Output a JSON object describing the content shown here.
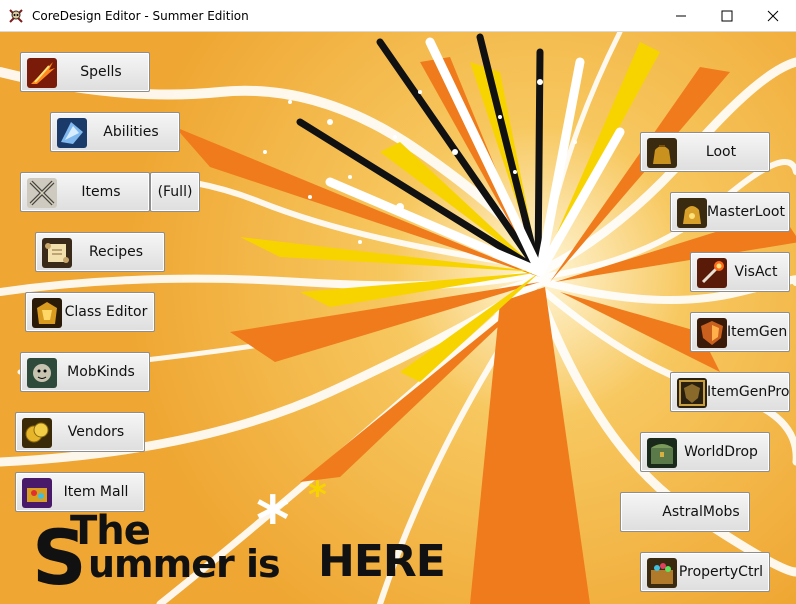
{
  "window": {
    "title": "CoreDesign Editor - Summer Edition"
  },
  "left_buttons": [
    {
      "label": "Spells",
      "icon": "fire-spell-icon"
    },
    {
      "label": "Abilities",
      "icon": "ice-shard-icon"
    },
    {
      "label": "Items",
      "icon": "crossed-swords-icon"
    },
    {
      "label": "Recipes",
      "icon": "scroll-icon"
    },
    {
      "label": "Class Editor",
      "icon": "golden-armor-icon"
    },
    {
      "label": "MobKinds",
      "icon": "creature-icon"
    },
    {
      "label": "Vendors",
      "icon": "gold-coins-icon"
    },
    {
      "label": "Item Mall",
      "icon": "treasure-icon"
    }
  ],
  "items_full_label": "(Full)",
  "right_buttons": [
    {
      "label": "Loot",
      "icon": "loot-bag-icon"
    },
    {
      "label": "MasterLoot",
      "icon": "master-loot-bag-icon"
    },
    {
      "label": "VisAct",
      "icon": "fire-wand-icon"
    },
    {
      "label": "ItemGen",
      "icon": "shield-icon"
    },
    {
      "label": "ItemGenPro",
      "icon": "framed-shield-icon"
    },
    {
      "label": "WorldDrop",
      "icon": "chest-icon"
    },
    {
      "label": "AstralMobs",
      "icon": ""
    },
    {
      "label": "PropertyCtrl",
      "icon": "gem-chest-icon"
    }
  ],
  "banner": {
    "line1": "The",
    "line2_big": "S",
    "line2_rest": "ummer is ",
    "line2_strong": "HERE"
  },
  "colors": {
    "background": "#f3b63f",
    "orange": "#ef7b1c",
    "white": "#ffffff"
  }
}
